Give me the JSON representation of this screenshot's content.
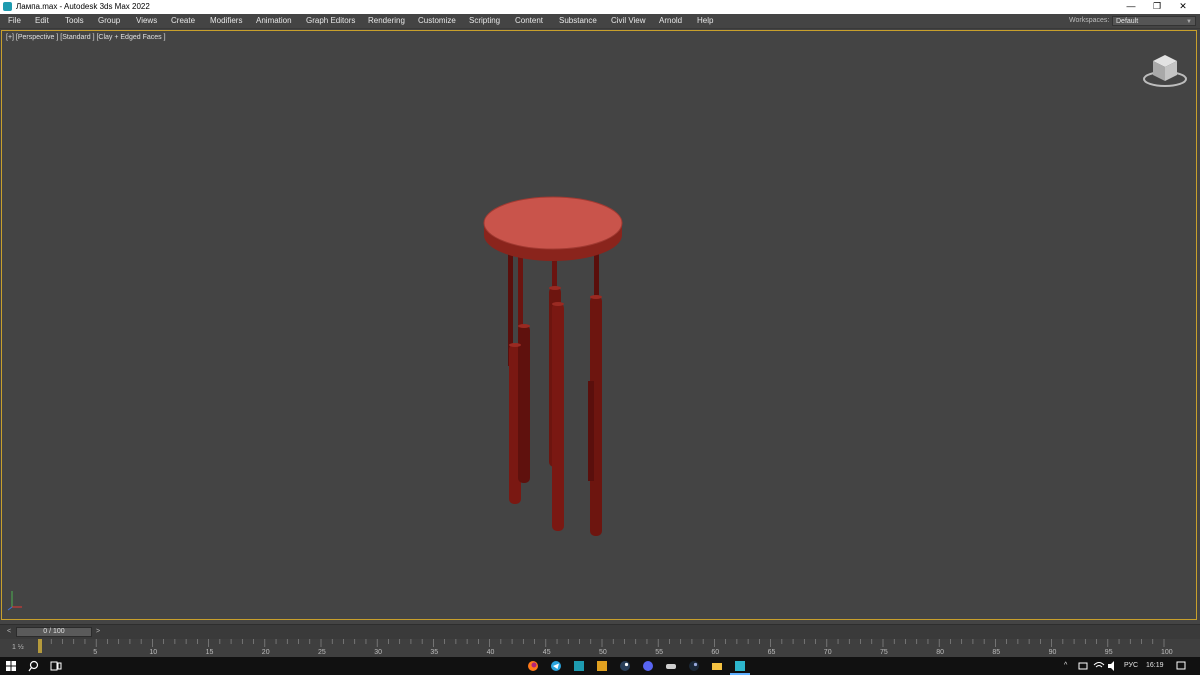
{
  "window": {
    "title": "Лампа.max - Autodesk 3ds Max 2022",
    "minimize_glyph": "—",
    "restore_glyph": "❐",
    "close_glyph": "✕"
  },
  "menu": {
    "items": [
      "File",
      "Edit",
      "Tools",
      "Group",
      "Views",
      "Create",
      "Modifiers",
      "Animation",
      "Graph Editors",
      "Rendering",
      "Customize",
      "Scripting",
      "Content",
      "Substance",
      "Civil View",
      "Arnold",
      "Help"
    ],
    "workspace_label": "Workspaces:",
    "workspace_value": "Default"
  },
  "viewport": {
    "label": "[+] [Perspective ] [Standard ] [Clay + Edged Faces ]",
    "model_color": "#8a1f1a",
    "disk_color": "#c9544b",
    "border_color": "#c8a02c"
  },
  "timeline": {
    "slider_text": "0 / 100",
    "prev_glyph": "<",
    "next_glyph": ">",
    "corner_label": "1 ½",
    "ticks": [
      "5",
      "10",
      "15",
      "20",
      "25",
      "30",
      "35",
      "40",
      "45",
      "50",
      "55",
      "60",
      "65",
      "70",
      "75",
      "80",
      "85",
      "90",
      "95",
      "100"
    ]
  },
  "taskbar": {
    "language": "РУС",
    "time": "16:19",
    "icons": [
      "windows-start-icon",
      "search-icon",
      "task-view-icon",
      "firefox-icon",
      "telegram-icon",
      "3dsmax-icon",
      "app-orange-icon",
      "steam-icon",
      "discord-icon",
      "gamepad-icon",
      "steam-alt-icon",
      "file-explorer-icon",
      "3dsmax-active-icon"
    ]
  }
}
